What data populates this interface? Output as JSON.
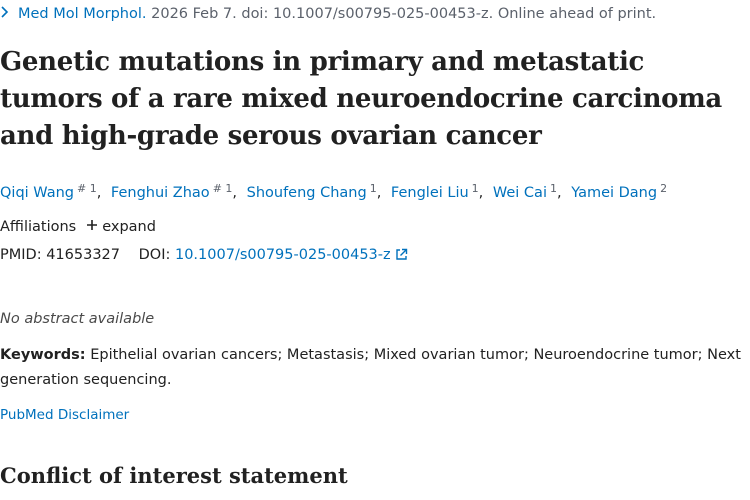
{
  "citation": {
    "journal": "Med Mol Morphol.",
    "details": " 2026 Feb 7. doi: 10.1007/s00795-025-00453-z. Online ahead of print."
  },
  "article": {
    "title": "Genetic mutations in primary and metastatic tumors of a rare mixed neuroendocrine carcinoma and high-grade serous ovarian cancer"
  },
  "authors": [
    {
      "name": "Qiqi Wang",
      "sup": "# 1"
    },
    {
      "name": "Fenghui Zhao",
      "sup": "# 1"
    },
    {
      "name": "Shoufeng Chang",
      "sup": "1"
    },
    {
      "name": "Fenglei Liu",
      "sup": "1"
    },
    {
      "name": "Wei Cai",
      "sup": "1"
    },
    {
      "name": "Yamei Dang",
      "sup": "2"
    }
  ],
  "affiliations": {
    "label": "Affiliations",
    "expand": "expand"
  },
  "identifiers": {
    "pmid_label": "PMID:",
    "pmid": "41653327",
    "doi_label": "DOI:",
    "doi": "10.1007/s00795-025-00453-z"
  },
  "abstract": {
    "text": "No abstract available"
  },
  "keywords": {
    "label": "Keywords:",
    "text": " Epithelial ovarian cancers; Metastasis; Mixed ovarian tumor; Neuroendocrine tumor; Next generation sequencing."
  },
  "disclaimer": {
    "label": "PubMed Disclaimer"
  },
  "sections": {
    "conflict": "Conflict of interest statement"
  },
  "colors": {
    "link": "#0071bc",
    "text": "#212121",
    "muted": "#5b616b"
  },
  "icons": {
    "journal": "chevron-right-icon",
    "doi": "external-link-icon",
    "expand": "plus-icon"
  }
}
